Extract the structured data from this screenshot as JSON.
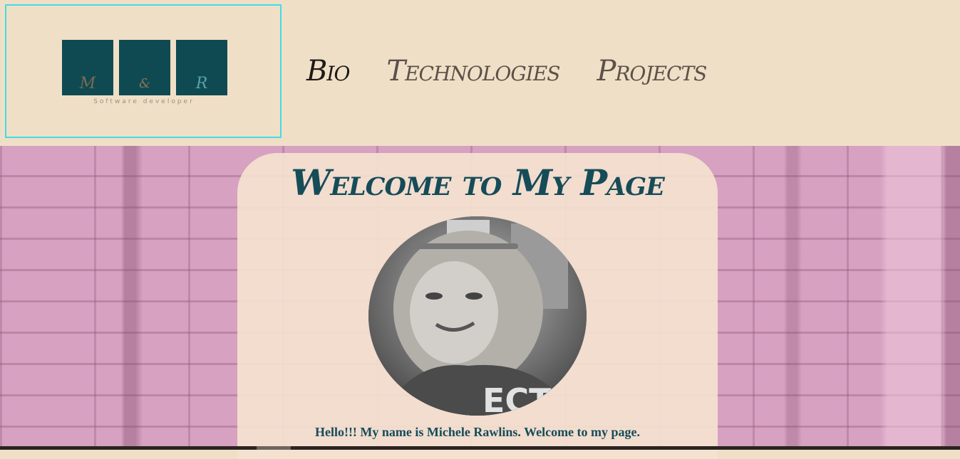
{
  "header": {
    "logo": {
      "letters": [
        "M",
        "&",
        "R"
      ],
      "tagline": "Software developer"
    },
    "nav": [
      {
        "label": "Bio",
        "active": true
      },
      {
        "label": "Technologies",
        "active": false
      },
      {
        "label": "Projects",
        "active": false
      }
    ]
  },
  "main": {
    "title": "Welcome to My Page",
    "intro": "Hello!!! My name is Michele Rawlins. Welcome to my page."
  },
  "colors": {
    "background": "#f0dfc7",
    "logo_border": "#40dde6",
    "logo_square": "#0f4a52",
    "accent_text": "#164c58",
    "brick_wall": "#d7a1c1"
  }
}
